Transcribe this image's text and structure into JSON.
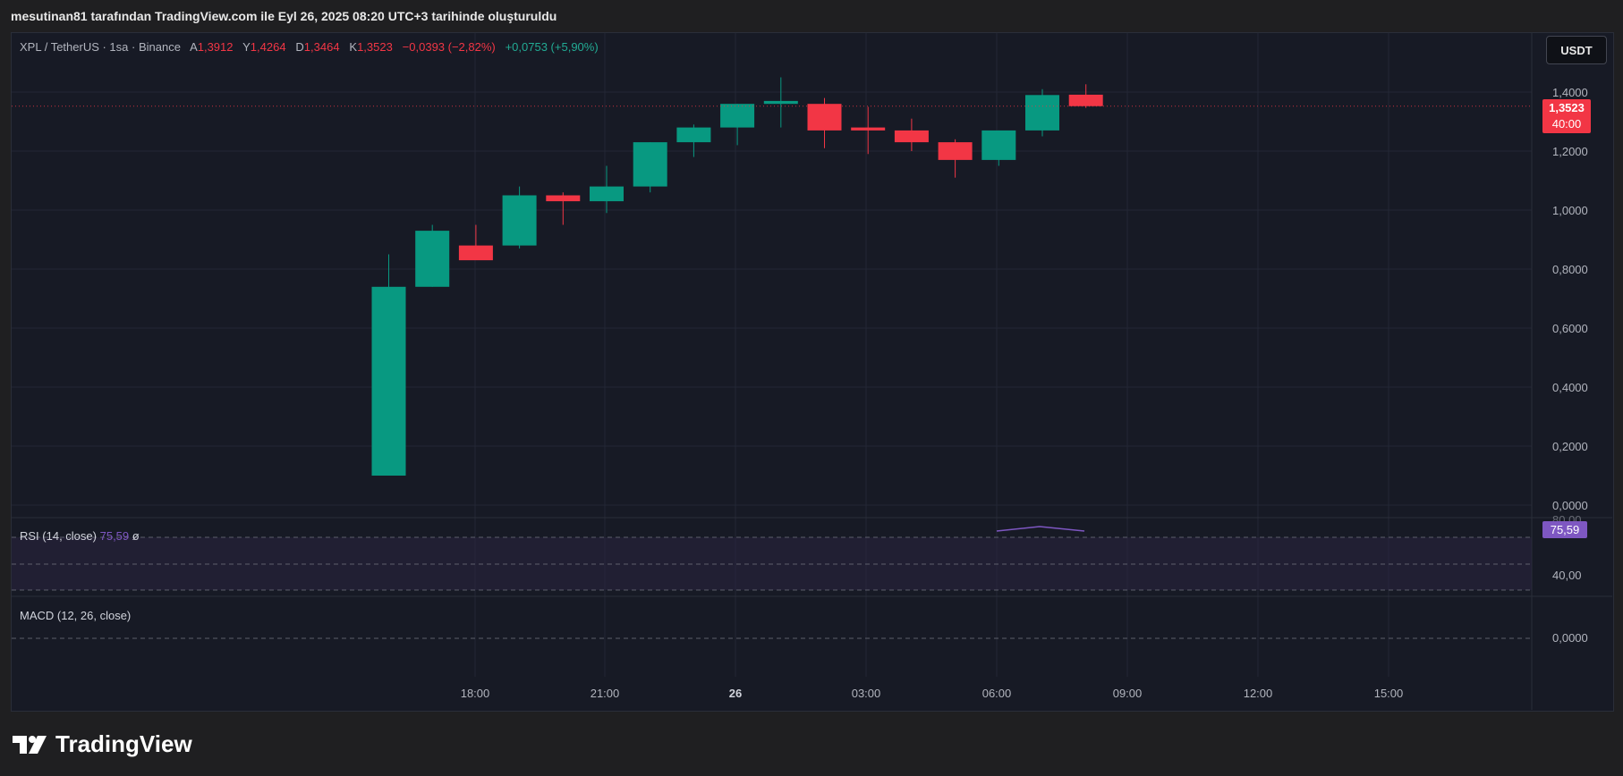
{
  "header": {
    "text": "mesutinan81 tarafından TradingView.com ile Eyl 26, 2025 08:20 UTC+3 tarihinde oluşturuldu"
  },
  "legend": {
    "symbol": "XPL / TetherUS · 1sa · Binance",
    "open_label": "A",
    "open": "1,3912",
    "high_label": "Y",
    "high": "1,4264",
    "low_label": "D",
    "low": "1,3464",
    "close_label": "K",
    "close": "1,3523",
    "change": "−0,0393 (−2,82%)",
    "volume_change": "+0,0753 (+5,90%)"
  },
  "currency_button": "USDT",
  "price_badge": {
    "price": "1,3523",
    "countdown": "40:00"
  },
  "rsi": {
    "label": "RSI (14, close)",
    "value": "75,59",
    "extra": "ø",
    "badge": "75,59",
    "axis_upper": "80,00",
    "axis_lower": "40,00"
  },
  "macd": {
    "label": "MACD (12, 26, close)",
    "axis_zero": "0,0000"
  },
  "footer": {
    "brand": "TradingView"
  },
  "colors": {
    "up": "#089981",
    "down": "#f23645",
    "rsi_line": "#7e57c2",
    "rsi_band": "#2a2440"
  },
  "chart_data": {
    "type": "candlestick",
    "y_axis_ticks": [
      "1,4000",
      "1,2000",
      "1,0000",
      "0,8000",
      "0,6000",
      "0,4000",
      "0,2000",
      "0,0000"
    ],
    "x_axis_ticks": [
      "18:00",
      "21:00",
      "26",
      "03:00",
      "06:00",
      "09:00",
      "12:00",
      "15:00"
    ],
    "ylim": [
      0,
      1.4
    ],
    "candles": [
      {
        "time": "17:00",
        "open": 0.1,
        "high": 0.85,
        "low": 0.1,
        "close": 0.74
      },
      {
        "time": "18:00",
        "open": 0.74,
        "high": 0.95,
        "low": 0.74,
        "close": 0.93
      },
      {
        "time": "19:00",
        "open": 0.88,
        "high": 0.95,
        "low": 0.84,
        "close": 0.83
      },
      {
        "time": "20:00",
        "open": 0.88,
        "high": 1.08,
        "low": 0.87,
        "close": 1.05
      },
      {
        "time": "21:00",
        "open": 1.05,
        "high": 1.06,
        "low": 0.95,
        "close": 1.03
      },
      {
        "time": "22:00",
        "open": 1.03,
        "high": 1.15,
        "low": 0.99,
        "close": 1.08
      },
      {
        "time": "23:00",
        "open": 1.08,
        "high": 1.23,
        "low": 1.06,
        "close": 1.23
      },
      {
        "time": "00:00",
        "open": 1.23,
        "high": 1.29,
        "low": 1.18,
        "close": 1.28
      },
      {
        "time": "01:00",
        "open": 1.28,
        "high": 1.36,
        "low": 1.22,
        "close": 1.36
      },
      {
        "time": "02:00",
        "open": 1.36,
        "high": 1.45,
        "low": 1.28,
        "close": 1.37
      },
      {
        "time": "03:00",
        "open": 1.36,
        "high": 1.38,
        "low": 1.21,
        "close": 1.27
      },
      {
        "time": "04:00",
        "open": 1.28,
        "high": 1.35,
        "low": 1.19,
        "close": 1.27
      },
      {
        "time": "05:00",
        "open": 1.27,
        "high": 1.31,
        "low": 1.2,
        "close": 1.23
      },
      {
        "time": "06:00",
        "open": 1.23,
        "high": 1.24,
        "low": 1.11,
        "close": 1.17
      },
      {
        "time": "07:00",
        "open": 1.17,
        "high": 1.27,
        "low": 1.15,
        "close": 1.27
      },
      {
        "time": "08:00",
        "open": 1.27,
        "high": 1.41,
        "low": 1.25,
        "close": 1.39
      },
      {
        "time": "09:00",
        "open": 1.3912,
        "high": 1.4264,
        "low": 1.3464,
        "close": 1.3523
      }
    ],
    "current_price": 1.3523
  }
}
